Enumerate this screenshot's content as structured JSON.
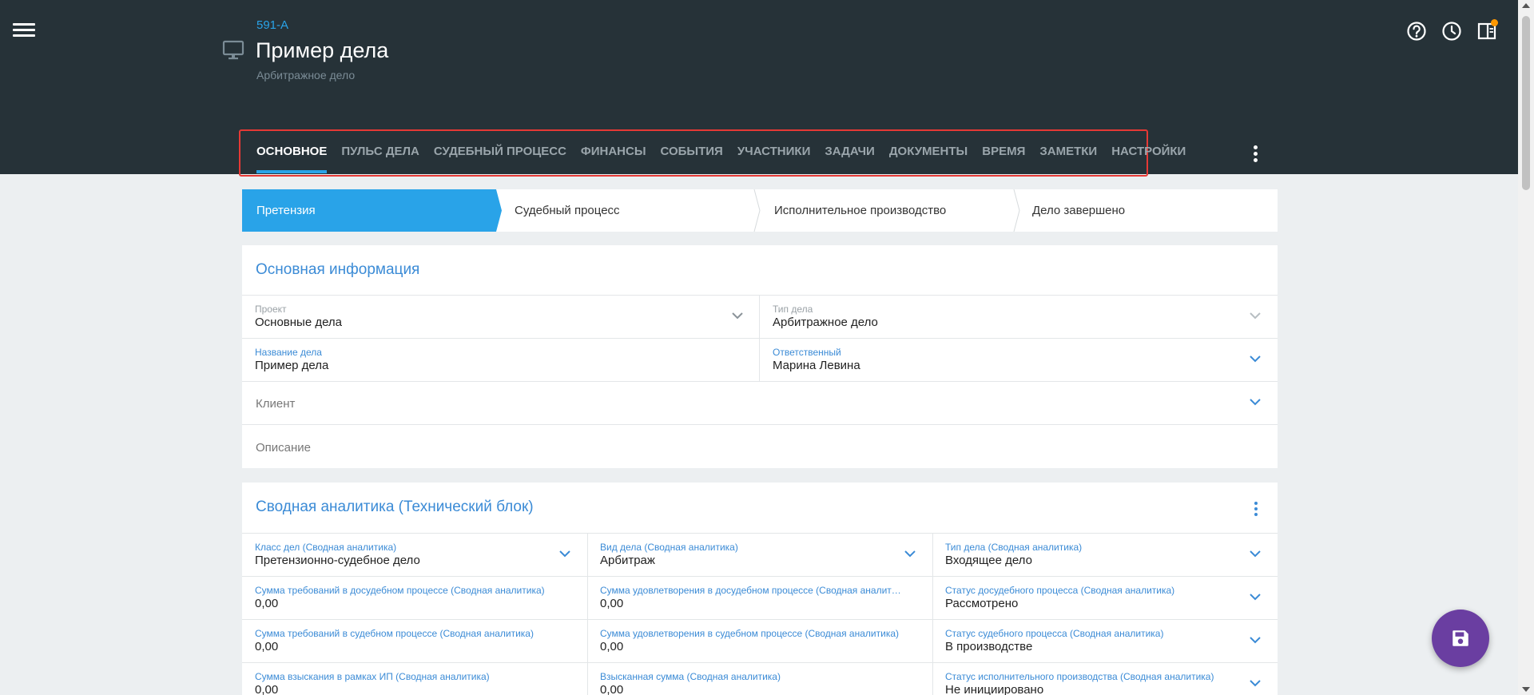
{
  "header": {
    "case_number": "591-A",
    "case_title": "Пример дела",
    "case_subtitle": "Арбитражное дело"
  },
  "tabs": [
    {
      "label": "ОСНОВНОЕ",
      "active": true
    },
    {
      "label": "ПУЛЬС ДЕЛА"
    },
    {
      "label": "СУДЕБНЫЙ ПРОЦЕСС"
    },
    {
      "label": "ФИНАНСЫ"
    },
    {
      "label": "СОБЫТИЯ"
    },
    {
      "label": "УЧАСТНИКИ"
    },
    {
      "label": "ЗАДАЧИ"
    },
    {
      "label": "ДОКУМЕНТЫ"
    },
    {
      "label": "ВРЕМЯ"
    },
    {
      "label": "ЗАМЕТКИ"
    },
    {
      "label": "НАСТРОЙКИ"
    }
  ],
  "stepper": [
    {
      "label": "Претензия",
      "active": true
    },
    {
      "label": "Судебный процесс"
    },
    {
      "label": "Исполнительное производство"
    },
    {
      "label": "Дело завершено"
    }
  ],
  "main_info": {
    "title": "Основная информация",
    "project_label": "Проект",
    "project_value": "Основные дела",
    "case_type_label": "Тип дела",
    "case_type_value": "Арбитражное дело",
    "case_name_label": "Название дела",
    "case_name_value": "Пример дела",
    "responsible_label": "Ответственный",
    "responsible_value": "Марина Левина",
    "client_placeholder": "Клиент",
    "description_placeholder": "Описание"
  },
  "analytics": {
    "title": "Сводная аналитика (Технический блок)",
    "rows": [
      [
        {
          "label": "Класс дел (Сводная аналитика)",
          "value": "Претензионно-судебное дело",
          "dropdown": true
        },
        {
          "label": "Вид дела (Сводная аналитика)",
          "value": "Арбитраж",
          "dropdown": true
        },
        {
          "label": "Тип дела (Сводная аналитика)",
          "value": "Входящее дело",
          "dropdown": true
        }
      ],
      [
        {
          "label": "Сумма требований в досудебном процессе (Сводная аналитика)",
          "value": "0,00"
        },
        {
          "label": "Сумма удовлетворения в досудебном процессе (Сводная аналит…",
          "value": "0,00"
        },
        {
          "label": "Статус досудебного процесса (Сводная аналитика)",
          "value": "Рассмотрено",
          "dropdown": true
        }
      ],
      [
        {
          "label": "Сумма требований в судебном процессе (Сводная аналитика)",
          "value": "0,00"
        },
        {
          "label": "Сумма удовлетворения в судебном процессе (Сводная аналитика)",
          "value": "0,00"
        },
        {
          "label": "Статус судебного процесса (Сводная аналитика)",
          "value": "В производстве",
          "dropdown": true
        }
      ],
      [
        {
          "label": "Сумма взыскания в рамках ИП (Сводная аналитика)",
          "value": "0,00"
        },
        {
          "label": "Взысканная сумма (Сводная аналитика)",
          "value": "0,00"
        },
        {
          "label": "Статус исполнительного производства (Сводная аналитика)",
          "value": "Не инициировано",
          "dropdown": true
        }
      ]
    ]
  },
  "colors": {
    "header_bg": "#263238",
    "accent": "#29a3e8",
    "link_blue": "#3b8bd6",
    "fab": "#6a3ea1",
    "highlight_box": "#e53935"
  },
  "icons": [
    "menu-icon",
    "monitor-icon",
    "help-icon",
    "history-icon",
    "panel-icon",
    "more-vert-icon",
    "chevron-down-icon",
    "save-icon"
  ]
}
